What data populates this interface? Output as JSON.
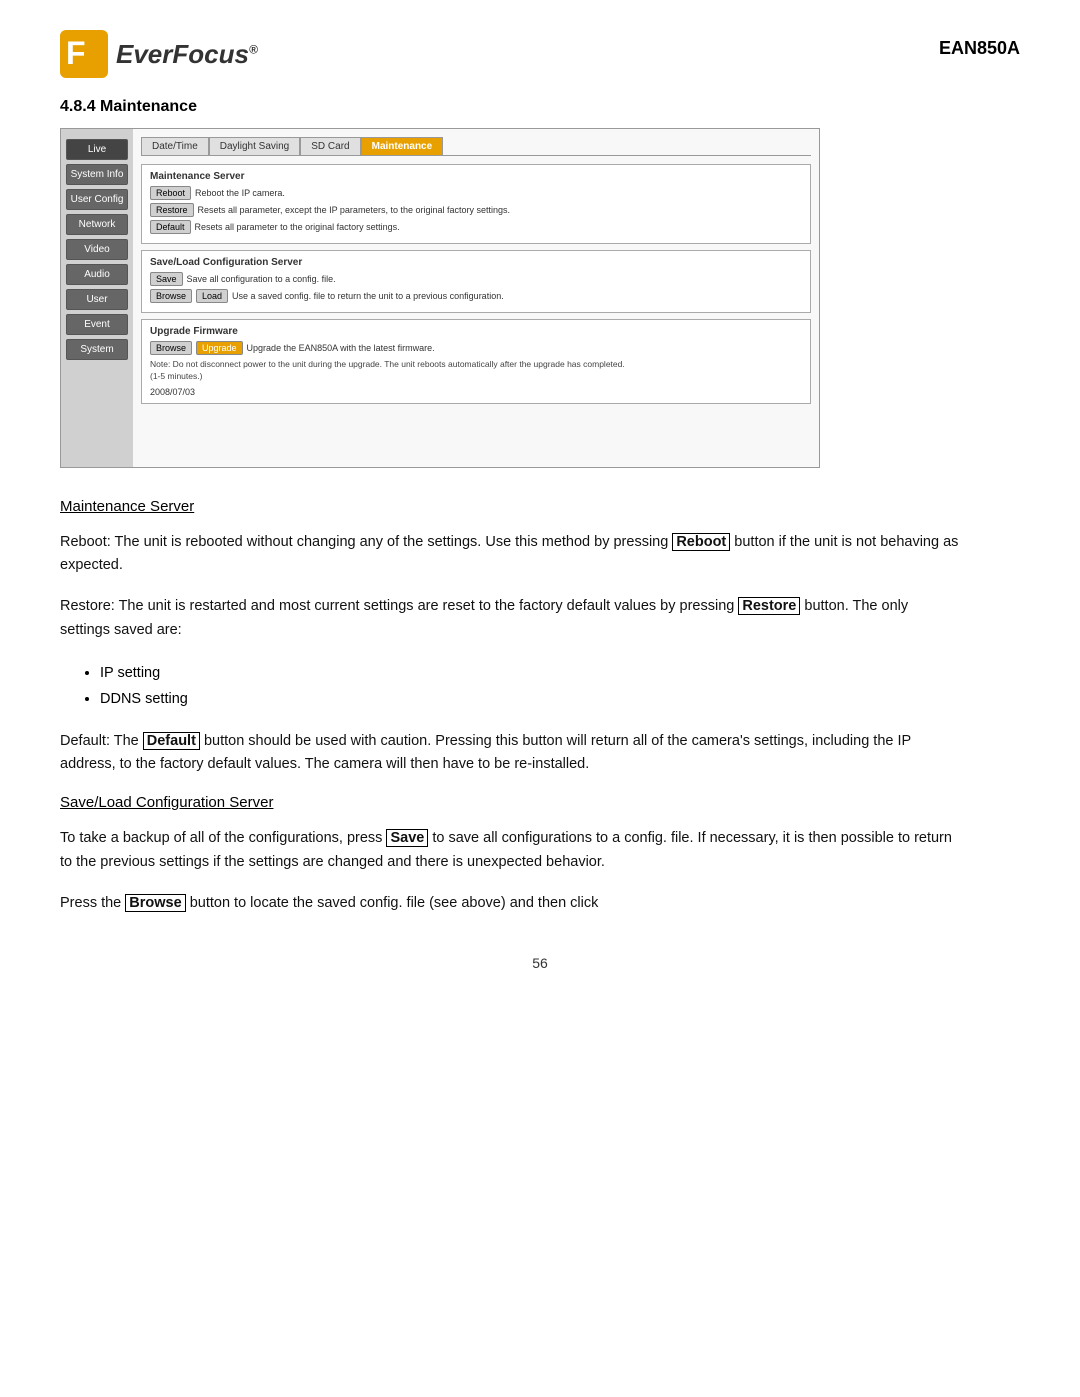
{
  "header": {
    "logo_text": "EverFocus",
    "logo_trademark": "®",
    "model": "EAN850A"
  },
  "section": {
    "number": "4.8.4",
    "title": "Maintenance"
  },
  "ui": {
    "sidebar": {
      "buttons": [
        "Live",
        "System Info",
        "User Config",
        "Network",
        "Video",
        "Audio",
        "User",
        "Event",
        "System"
      ]
    },
    "tabs": [
      "Date/Time",
      "Daylight Saving",
      "SD Card",
      "Maintenance"
    ],
    "active_tab": "Maintenance",
    "panels": {
      "maintenance_server": {
        "title": "Maintenance Server",
        "rows": [
          {
            "button": "Reboot",
            "description": "Reboot the IP camera."
          },
          {
            "button": "Restore",
            "description": "Resets all parameter, except the IP parameters, to the original factory settings."
          },
          {
            "button": "Default",
            "description": "Resets all parameter to the original factory settings."
          }
        ]
      },
      "save_load": {
        "title": "Save/Load Configuration Server",
        "save_row": {
          "button": "Save",
          "description": "Save all configuration to a config. file."
        },
        "load_row": {
          "buttons": [
            "Browse",
            "Load"
          ],
          "description": "Use a saved config. file to return the unit to a previous configuration."
        }
      },
      "upgrade_firmware": {
        "title": "Upgrade Firmware",
        "buttons": [
          "Browse",
          "Upgrade"
        ],
        "description": "Upgrade the EAN850A with the latest firmware.",
        "note": "Note: Do not disconnect power to the unit during the upgrade. The unit reboots automatically after the upgrade has completed. (1-5 minutes.)",
        "date": "2008/07/03"
      }
    }
  },
  "content": {
    "maintenance_server_heading": "Maintenance Server",
    "paragraphs": [
      {
        "text_before": "Reboot: The unit is rebooted without changing any of the settings. Use this method by pressing ",
        "bold": "Reboot",
        "text_after": " button if the unit is not behaving as expected."
      },
      {
        "text_before": "Restore: The unit is restarted and most current settings are reset to the factory default values by pressing ",
        "bold": "Restore",
        "text_after": " button. The only settings saved are:"
      }
    ],
    "bullet_items": [
      "IP setting",
      "DDNS setting"
    ],
    "paragraph_default": {
      "text_before": "Default: The ",
      "bold": "Default",
      "text_after": " button should be used with caution. Pressing this button will return all of the camera's settings, including the IP address, to the factory default values. The camera will then have to be re-installed."
    },
    "save_load_heading": "Save/Load Configuration Server",
    "paragraph_save": {
      "text_before": "To take a backup of all of the configurations, press ",
      "bold": "Save",
      "text_after": " to save all configurations to a config. file. If necessary, it is then possible to return to the previous settings if the settings are changed and there is unexpected behavior."
    },
    "paragraph_browse": {
      "text_before": "Press the ",
      "bold": "Browse",
      "text_after": " button to locate the saved config. file (see above) and then click"
    }
  },
  "page_number": "56"
}
